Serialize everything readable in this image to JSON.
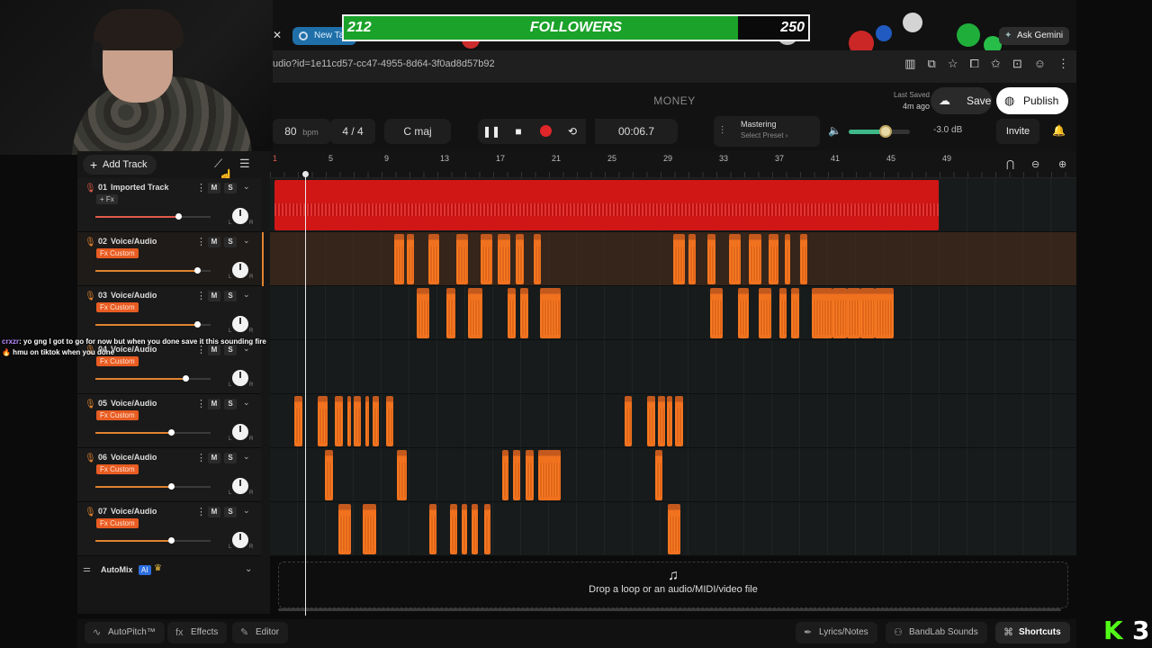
{
  "followers": {
    "current": "212",
    "label": "FOLLOWERS",
    "goal": "250",
    "progress": 0.848,
    "bar_color": "#1ba22a"
  },
  "chat": {
    "user": "crxzr",
    "message": ": yo gng I got to go for now but when you done save it this sounding fire🔥 hmu on tiktok when you done"
  },
  "browser": {
    "tab_label": "New Tab",
    "url": "udio?id=1e11cd57-cc47-4955-8d64-3f0ad8d57b92",
    "gemini_label": "Ask Gemini"
  },
  "header": {
    "title": "MONEY",
    "last_saved_label": "Last Saved",
    "last_saved_ago": "4m ago",
    "save_label": "Save",
    "publish_label": "Publish"
  },
  "transport": {
    "bpm": "80",
    "bpm_unit": "bpm",
    "time_sig": "4 / 4",
    "key": "C maj",
    "time": "00:06.7",
    "mastering_label": "Mastering",
    "mastering_preset": "Select Preset ›",
    "volume_level": 0.6,
    "volume_db": "-3.0 dB",
    "invite_label": "Invite",
    "record_color": "#e0262a"
  },
  "panel": {
    "add_track_label": "Add Track"
  },
  "tracks": [
    {
      "num": "01",
      "name": "Imported Track",
      "fx": "+ Fx",
      "fx_style": "plain",
      "volume": 0.72,
      "mic": "#e05a4a"
    },
    {
      "num": "02",
      "name": "Voice/Audio",
      "fx": "Fx Custom",
      "fx_style": "orange",
      "volume": 0.88,
      "mic": "#e0842f"
    },
    {
      "num": "03",
      "name": "Voice/Audio",
      "fx": "Fx Custom",
      "fx_style": "orange",
      "volume": 0.88,
      "mic": "#e0842f"
    },
    {
      "num": "04",
      "name": "Voice/Audio",
      "fx": "Fx Custom",
      "fx_style": "orange",
      "volume": 0.78,
      "mic": "#e0842f"
    },
    {
      "num": "05",
      "name": "Voice/Audio",
      "fx": "Fx Custom",
      "fx_style": "orange",
      "volume": 0.66,
      "mic": "#e0842f"
    },
    {
      "num": "06",
      "name": "Voice/Audio",
      "fx": "Fx Custom",
      "fx_style": "orange",
      "volume": 0.66,
      "mic": "#e0842f"
    },
    {
      "num": "07",
      "name": "Voice/Audio",
      "fx": "Fx Custom",
      "fx_style": "orange",
      "volume": 0.66,
      "mic": "#e0842f"
    }
  ],
  "track_buttons": {
    "mute": "M",
    "solo": "S",
    "left": "L",
    "right": "R"
  },
  "automix": {
    "label": "AutoMix",
    "ai": "AI"
  },
  "ruler_bars": [
    "1",
    "5",
    "9",
    "13",
    "17",
    "21",
    "25",
    "29",
    "33",
    "37",
    "41",
    "45",
    "49"
  ],
  "lanes": [
    {
      "color": "red",
      "clips": [
        [
          1,
          48.6
        ]
      ]
    },
    {
      "color": "orange",
      "clips": [
        [
          9.6,
          10.3
        ],
        [
          10.5,
          11.0
        ],
        [
          12.0,
          12.8
        ],
        [
          14.0,
          14.9
        ],
        [
          15.8,
          16.6
        ],
        [
          17.0,
          17.9
        ],
        [
          18.3,
          18.9
        ],
        [
          19.6,
          20.1
        ],
        [
          29.6,
          30.4
        ],
        [
          30.7,
          31.2
        ],
        [
          32.0,
          32.6
        ],
        [
          33.6,
          34.4
        ],
        [
          35.0,
          35.9
        ],
        [
          36.4,
          37.1
        ],
        [
          37.6,
          38.0
        ],
        [
          38.7,
          39.2
        ]
      ]
    },
    {
      "color": "orange",
      "clips": [
        [
          11.2,
          12.1
        ],
        [
          13.3,
          14.0
        ],
        [
          14.9,
          15.9
        ],
        [
          17.7,
          18.3
        ],
        [
          18.6,
          19.2
        ],
        [
          20.0,
          21.5
        ],
        [
          32.2,
          33.1
        ],
        [
          34.2,
          35.0
        ],
        [
          35.7,
          36.6
        ],
        [
          37.2,
          37.7
        ],
        [
          38.0,
          38.6
        ],
        [
          39.5,
          41.0
        ],
        [
          41.0,
          42.0
        ],
        [
          42.0,
          43.0
        ],
        [
          43.0,
          44.0
        ],
        [
          44.0,
          45.4
        ]
      ]
    },
    {
      "color": "orange",
      "clips": []
    },
    {
      "color": "orange",
      "clips": [
        [
          2.4,
          3.0
        ],
        [
          4.1,
          4.8
        ],
        [
          5.3,
          5.9
        ],
        [
          6.2,
          6.5
        ],
        [
          6.7,
          7.2
        ],
        [
          7.5,
          7.8
        ],
        [
          8.0,
          8.5
        ],
        [
          9.0,
          9.5
        ],
        [
          26.1,
          26.6
        ],
        [
          27.7,
          28.3
        ],
        [
          28.5,
          29.0
        ],
        [
          29.1,
          29.5
        ],
        [
          29.7,
          30.3
        ]
      ]
    },
    {
      "color": "orange",
      "clips": [
        [
          4.6,
          5.2
        ],
        [
          9.8,
          10.5
        ],
        [
          17.3,
          17.8
        ],
        [
          18.1,
          18.6
        ],
        [
          19.0,
          19.6
        ],
        [
          19.9,
          21.5
        ],
        [
          28.3,
          28.8
        ]
      ]
    },
    {
      "color": "orange",
      "clips": [
        [
          5.6,
          6.5
        ],
        [
          7.3,
          8.3
        ],
        [
          12.1,
          12.6
        ],
        [
          13.6,
          14.1
        ],
        [
          14.4,
          14.8
        ],
        [
          15.1,
          15.6
        ],
        [
          16.0,
          16.5
        ],
        [
          29.2,
          30.1
        ]
      ]
    }
  ],
  "selected_lane": 1,
  "playhead_bar": 3.2,
  "drop_zone_label": "Drop a loop or an audio/MIDI/video file",
  "bottom_bar": {
    "autopitch": "AutoPitch™",
    "effects": "Effects",
    "editor": "Editor",
    "lyrics": "Lyrics/Notes",
    "bandlab_sounds": "BandLab Sounds",
    "shortcuts": "Shortcuts"
  },
  "kick_logo": {
    "k": "K",
    "num": "3"
  }
}
